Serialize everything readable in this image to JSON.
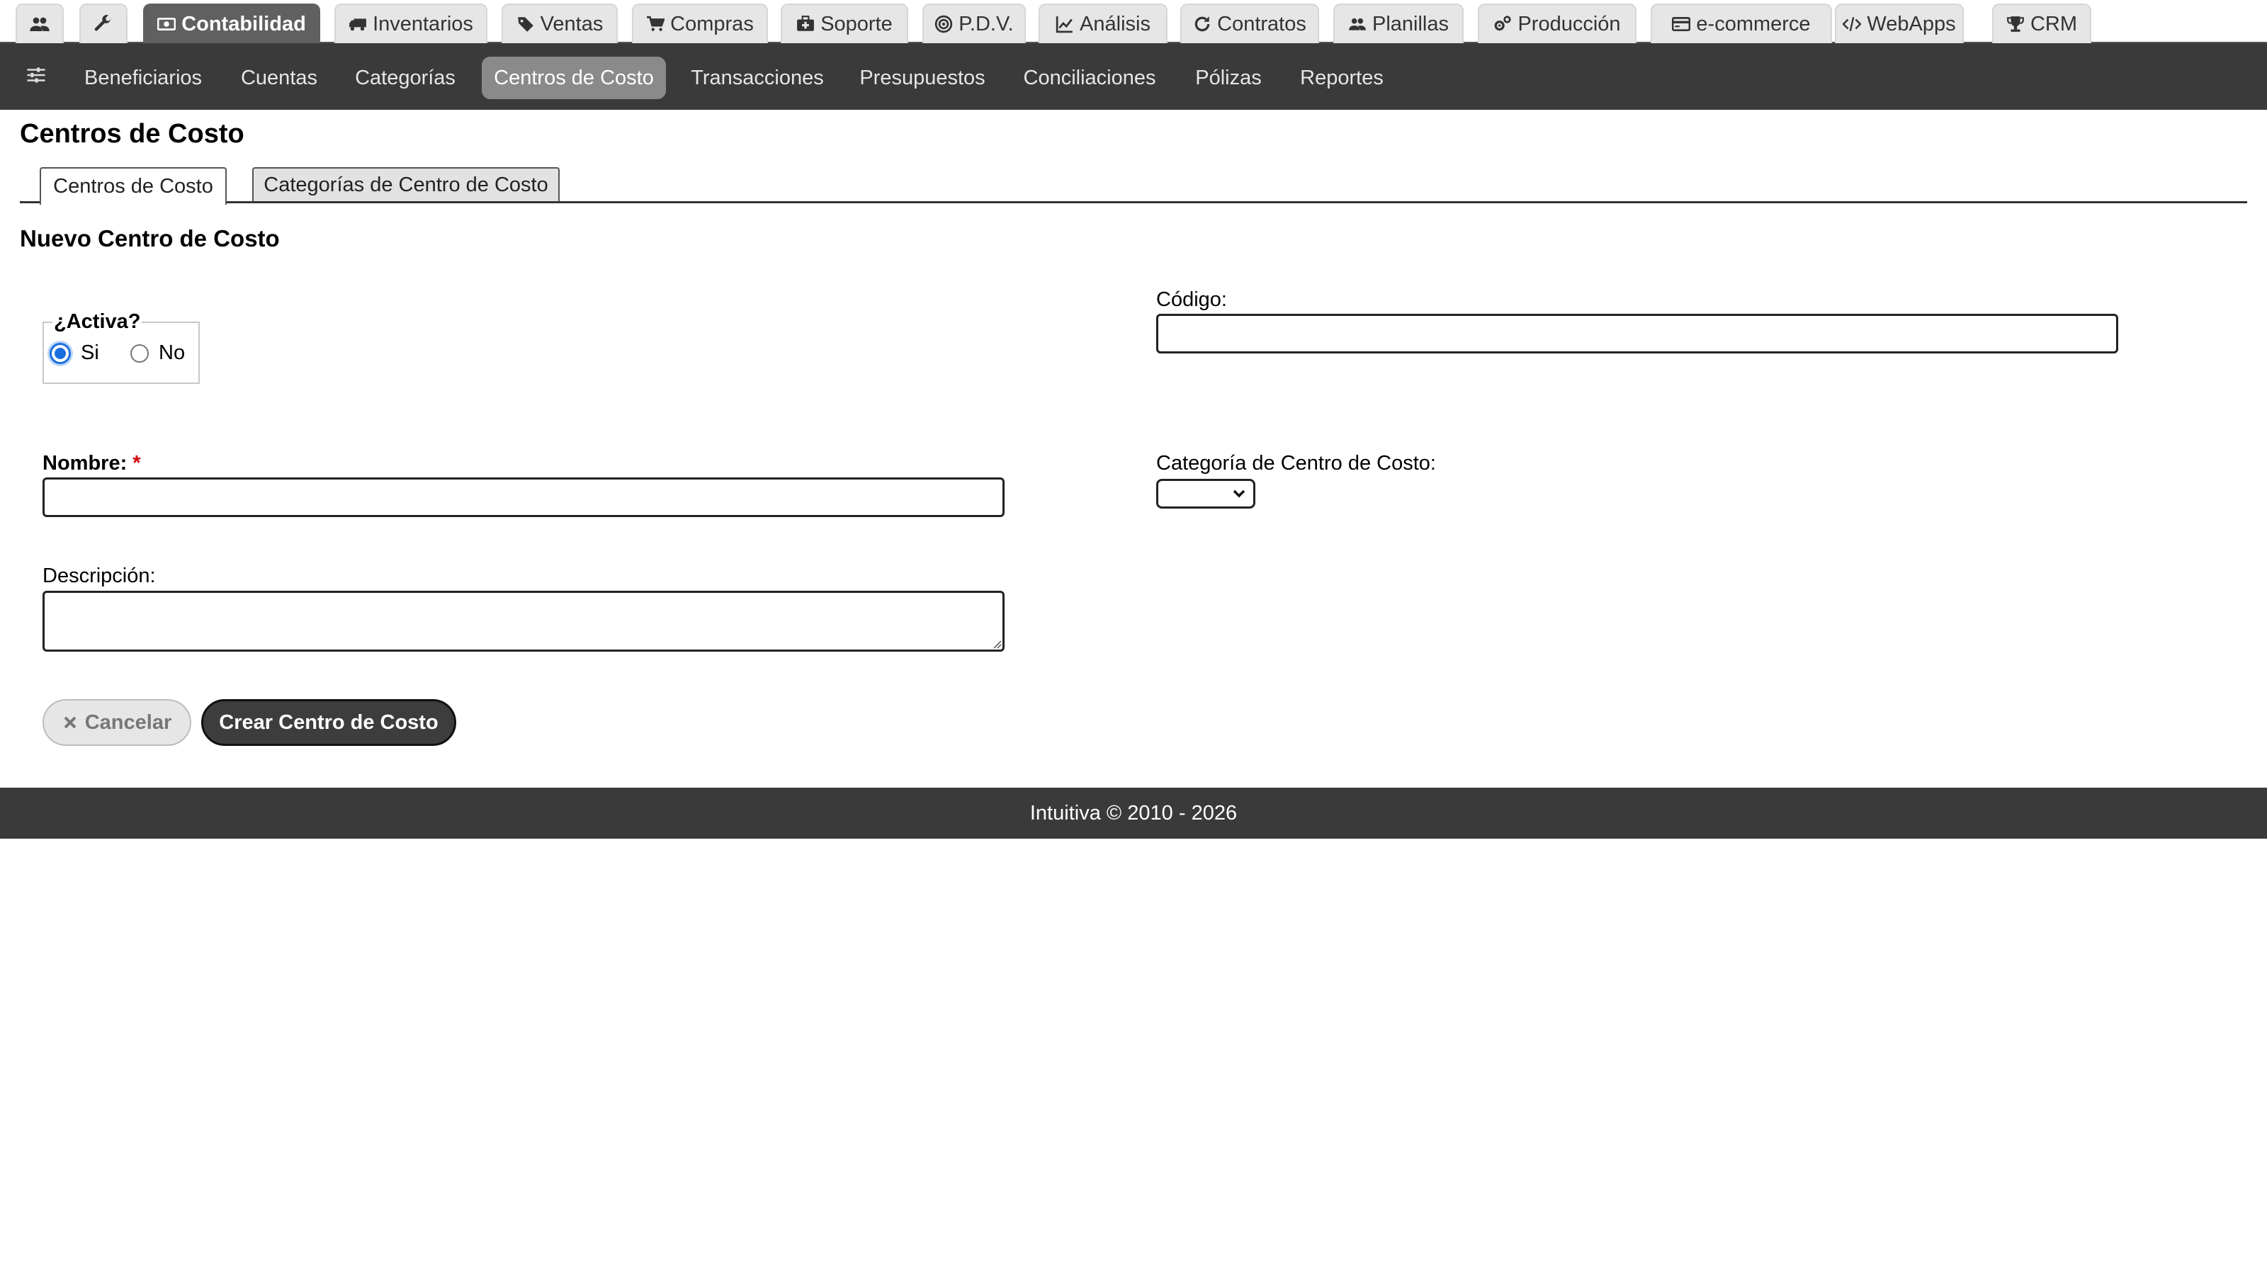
{
  "modules": [
    {
      "name": "users",
      "label": "",
      "icon": "users-icon"
    },
    {
      "name": "tools",
      "label": "",
      "icon": "wrench-icon"
    },
    {
      "name": "contabilidad",
      "label": "Contabilidad",
      "icon": "money-icon",
      "active": true
    },
    {
      "name": "inventarios",
      "label": "Inventarios",
      "icon": "truck-icon"
    },
    {
      "name": "ventas",
      "label": "Ventas",
      "icon": "tags-icon"
    },
    {
      "name": "compras",
      "label": "Compras",
      "icon": "cart-icon"
    },
    {
      "name": "soporte",
      "label": "Soporte",
      "icon": "medkit-icon"
    },
    {
      "name": "pdv",
      "label": "P.D.V.",
      "icon": "target-icon"
    },
    {
      "name": "analisis",
      "label": "Análisis",
      "icon": "line-chart-icon"
    },
    {
      "name": "contratos",
      "label": "Contratos",
      "icon": "refresh-icon"
    },
    {
      "name": "planillas",
      "label": "Planillas",
      "icon": "users-icon"
    },
    {
      "name": "produccion",
      "label": "Producción",
      "icon": "cogs-icon"
    },
    {
      "name": "ecommerce",
      "label": "e-commerce",
      "icon": "credit-card-icon"
    },
    {
      "name": "webapps",
      "label": "WebApps",
      "icon": "code-icon"
    },
    {
      "name": "crm",
      "label": "CRM",
      "icon": "trophy-icon"
    }
  ],
  "subnav": {
    "icon": "sliders-icon",
    "items": [
      {
        "label": "Beneficiarios"
      },
      {
        "label": "Cuentas"
      },
      {
        "label": "Categorías"
      },
      {
        "label": "Centros de Costo",
        "active": true
      },
      {
        "label": "Transacciones"
      },
      {
        "label": "Presupuestos"
      },
      {
        "label": "Conciliaciones"
      },
      {
        "label": "Pólizas"
      },
      {
        "label": "Reportes"
      }
    ]
  },
  "page": {
    "title": "Centros de Costo",
    "tabs": [
      {
        "label": "Centros de Costo",
        "active": true
      },
      {
        "label": "Categorías de Centro de Costo"
      }
    ],
    "form_title": "Nuevo Centro de Costo"
  },
  "form": {
    "active": {
      "legend": "¿Activa?",
      "options": [
        {
          "label": "Si",
          "checked": true
        },
        {
          "label": "No",
          "checked": false
        }
      ]
    },
    "codigo_label": "Código:",
    "codigo_value": "",
    "nombre_label": "Nombre:",
    "nombre_required_mark": "*",
    "nombre_value": "",
    "categoria_label": "Categoría de Centro de Costo:",
    "categoria_value": "",
    "descripcion_label": "Descripción:",
    "descripcion_value": "",
    "cancel_label": "Cancelar",
    "cancel_icon": "close-icon",
    "submit_label": "Crear Centro de Costo"
  },
  "footer": {
    "text": "Intuitiva © 2010 - 2026"
  },
  "colors": {
    "nav_dark": "#3a3a3a",
    "active_module": "#606060",
    "active_subnav": "#8a8a8a",
    "radio_accent": "#1a6fe0",
    "required_mark": "#d40000"
  }
}
